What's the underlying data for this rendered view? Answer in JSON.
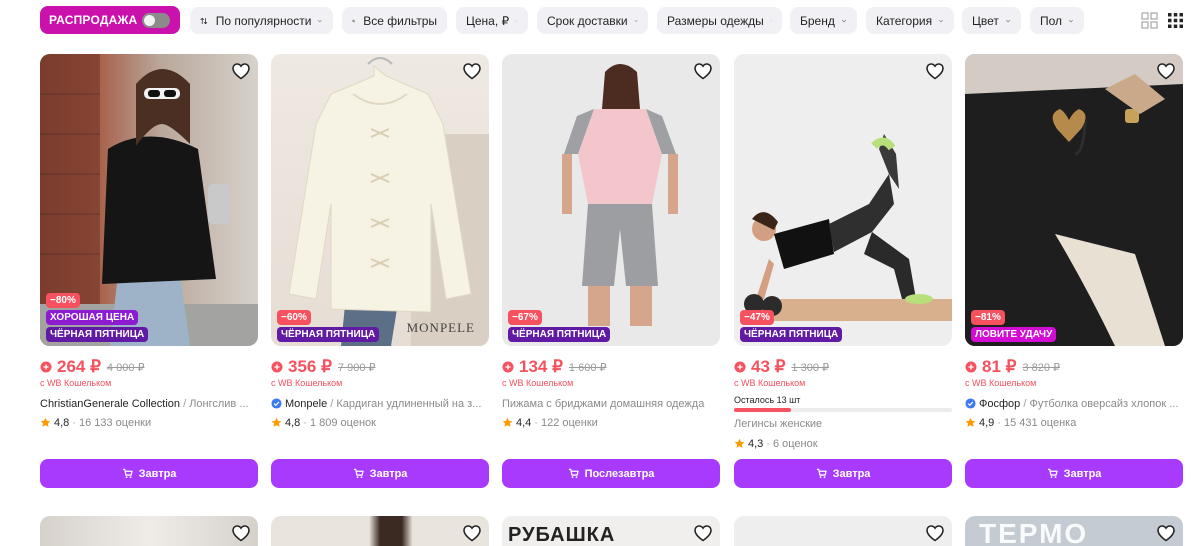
{
  "filters": {
    "sale_label": "РАСПРОДАЖА",
    "sort_label": "По популярности",
    "all_filters_label": "Все фильтры",
    "price_label": "Цена, ₽",
    "delivery_label": "Срок доставки",
    "sizes_label": "Размеры одежды",
    "brand_label": "Бренд",
    "category_label": "Категория",
    "color_label": "Цвет",
    "gender_label": "Пол"
  },
  "products": [
    {
      "badges": [
        "−80%",
        "ХОРОШАЯ ЦЕНА",
        "ЧЁРНАЯ ПЯТНИЦА"
      ],
      "price": "264 ₽",
      "old_price": "4 000 ₽",
      "wallet": "с WB Кошельком",
      "brand": "ChristianGenerale Collection",
      "name": "Лонгслив ...",
      "rating": "4,8",
      "reviews": "16 133 оценки",
      "button": "Завтра"
    },
    {
      "badges": [
        "−60%",
        "ЧЁРНАЯ ПЯТНИЦА"
      ],
      "price": "356 ₽",
      "old_price": "7 900 ₽",
      "wallet": "с WB Кошельком",
      "brand": "Monpele",
      "name": "Кардиган удлиненный на з...",
      "rating": "4,8",
      "reviews": "1 809 оценок",
      "image_text": "MONPELE",
      "button": "Завтра"
    },
    {
      "badges": [
        "−67%",
        "ЧЁРНАЯ ПЯТНИЦА"
      ],
      "price": "134 ₽",
      "old_price": "1 600 ₽",
      "wallet": "с WB Кошельком",
      "name": "Пижама с бриджами домашняя одежда",
      "rating": "4,4",
      "reviews": "122 оценки",
      "button": "Послезавтра"
    },
    {
      "badges": [
        "−47%",
        "ЧЁРНАЯ ПЯТНИЦА"
      ],
      "price": "43 ₽",
      "old_price": "1 300 ₽",
      "wallet": "с WB Кошельком",
      "stock_label": "Осталось 13 шт",
      "stock_fraction": 0.26,
      "name": "Легинсы женские",
      "rating": "4,3",
      "reviews": "6 оценок",
      "button": "Завтра"
    },
    {
      "badges": [
        "−81%",
        "ЛОВИТЕ УДАЧУ"
      ],
      "price": "81 ₽",
      "old_price": "3 820 ₽",
      "wallet": "с WB Кошельком",
      "brand": "Фосфор",
      "name": "Футболка оверсайз хлопок ...",
      "rating": "4,9",
      "reviews": "15 431 оценка",
      "button": "Завтра"
    }
  ],
  "row2_texts": [
    "РУБАШКА",
    "ТЕРМО"
  ],
  "colors": {
    "sale_chip": "#cb11ab",
    "price": "#f5515f",
    "button": "#a73afd",
    "chip_bg": "#f1f1f5"
  }
}
